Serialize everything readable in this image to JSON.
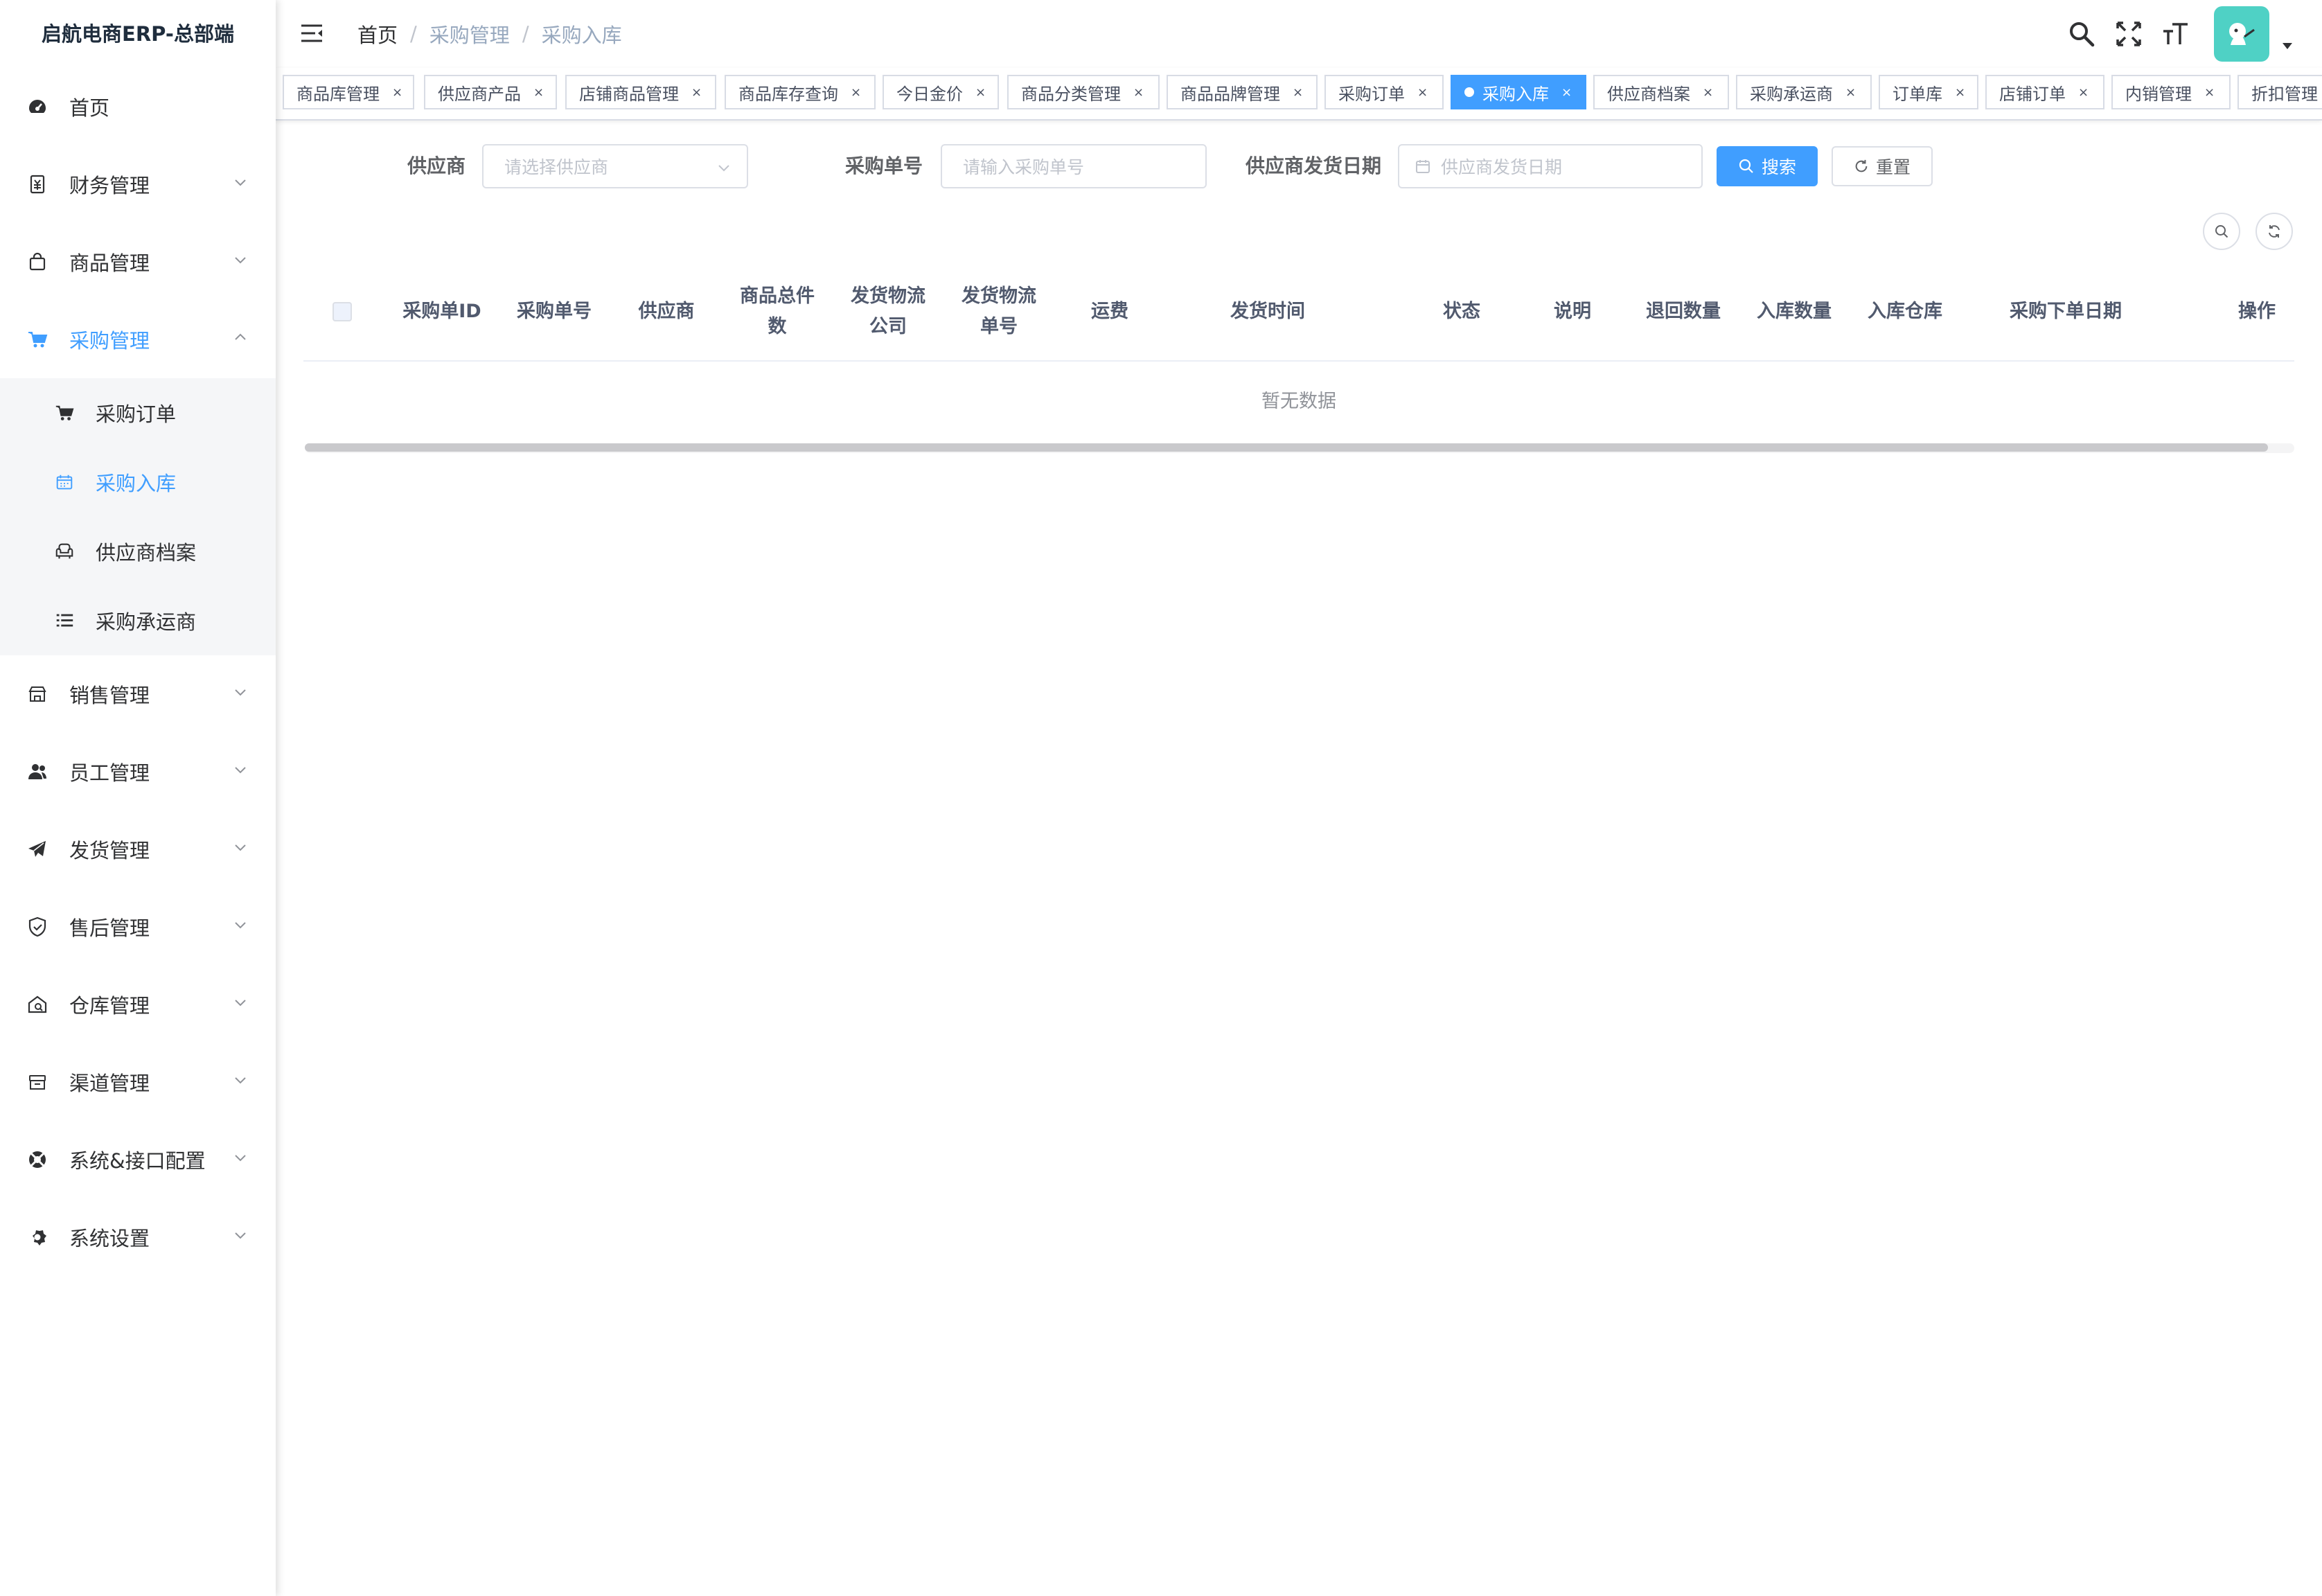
{
  "app_title": "启航电商ERP-总部端",
  "sidebar": {
    "items": [
      {
        "label": "首页"
      },
      {
        "label": "财务管理"
      },
      {
        "label": "商品管理"
      },
      {
        "label": "采购管理"
      },
      {
        "label": "销售管理"
      },
      {
        "label": "员工管理"
      },
      {
        "label": "发货管理"
      },
      {
        "label": "售后管理"
      },
      {
        "label": "仓库管理"
      },
      {
        "label": "渠道管理"
      },
      {
        "label": "系统&接口配置"
      },
      {
        "label": "系统设置"
      }
    ],
    "submenu": [
      {
        "label": "采购订单"
      },
      {
        "label": "采购入库"
      },
      {
        "label": "供应商档案"
      },
      {
        "label": "采购承运商"
      }
    ]
  },
  "breadcrumb": {
    "home": "首页",
    "separator": "/",
    "middle": "采购管理",
    "current": "采购入库"
  },
  "tags": [
    {
      "label": "商品库管理",
      "close": "×"
    },
    {
      "label": "供应商产品",
      "close": "×"
    },
    {
      "label": "店铺商品管理",
      "close": "×"
    },
    {
      "label": "商品库存查询",
      "close": "×"
    },
    {
      "label": "今日金价",
      "close": "×"
    },
    {
      "label": "商品分类管理",
      "close": "×"
    },
    {
      "label": "商品品牌管理",
      "close": "×"
    },
    {
      "label": "采购订单",
      "close": "×"
    },
    {
      "label": "采购入库",
      "close": "×"
    },
    {
      "label": "供应商档案",
      "close": "×"
    },
    {
      "label": "采购承运商",
      "close": "×"
    },
    {
      "label": "订单库",
      "close": "×"
    },
    {
      "label": "店铺订单",
      "close": "×"
    },
    {
      "label": "内销管理",
      "close": "×"
    },
    {
      "label": "折扣管理",
      "close": "×"
    }
  ],
  "filters": {
    "supplier_label": "供应商",
    "supplier_placeholder": "请选择供应商",
    "order_no_label": "采购单号",
    "order_no_placeholder": "请输入采购单号",
    "ship_date_label": "供应商发货日期",
    "ship_date_placeholder": "供应商发货日期",
    "search_button": "搜索",
    "reset_button": "重置"
  },
  "table": {
    "columns": [
      [
        "采购单ID"
      ],
      [
        "采购单号"
      ],
      [
        "供应商"
      ],
      [
        "商品总件",
        "数"
      ],
      [
        "发货物流",
        "公司"
      ],
      [
        "发货物流",
        "单号"
      ],
      [
        "运费"
      ],
      [
        "发货时间"
      ],
      [
        "状态"
      ],
      [
        "说明"
      ],
      [
        "退回数量"
      ],
      [
        "入库数量"
      ],
      [
        "入库仓库"
      ],
      [
        "采购下单日期"
      ],
      [
        "操作"
      ]
    ],
    "empty_text": "暂无数据"
  },
  "colors": {
    "primary": "#409eff",
    "avatar_bg": "#4fd1c5",
    "menu_active": "#409eff"
  }
}
